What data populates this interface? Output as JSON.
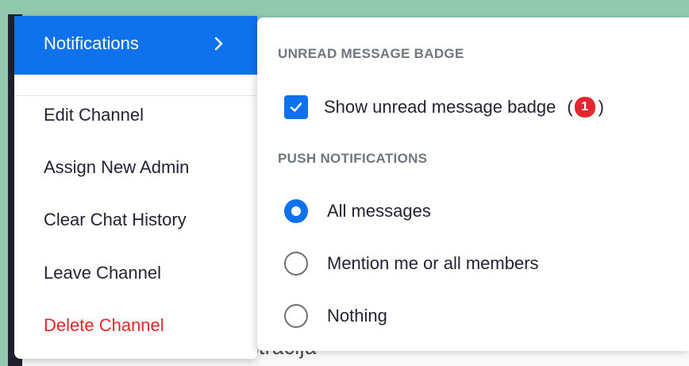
{
  "menu": {
    "notifications_label": "Notifications",
    "items": [
      {
        "label": "Edit Channel"
      },
      {
        "label": "Assign New Admin"
      },
      {
        "label": "Clear Chat History"
      },
      {
        "label": "Leave Channel"
      },
      {
        "label": "Delete Channel"
      }
    ]
  },
  "submenu": {
    "badge_section_title": "UNREAD MESSAGE BADGE",
    "badge_option_label": "Show unread message badge",
    "badge_option_checked": true,
    "badge_paren_open": "(",
    "badge_count": "1",
    "badge_paren_close": ")",
    "push_section_title": "PUSH NOTIFICATIONS",
    "push_options": [
      {
        "label": "All messages",
        "selected": true
      },
      {
        "label": "Mention me or all members",
        "selected": false
      },
      {
        "label": "Nothing",
        "selected": false
      }
    ]
  },
  "background": {
    "partial_text": "listracija"
  },
  "colors": {
    "accent": "#0e72ed",
    "danger": "#e02828",
    "badge": "#e5262f",
    "backdrop": "#92c9ae"
  }
}
